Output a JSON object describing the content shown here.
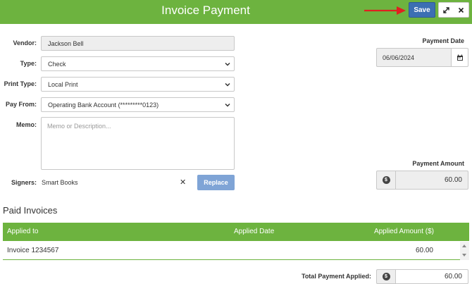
{
  "header": {
    "title": "Invoice Payment",
    "save_label": "Save",
    "expand_icon": "expand-icon",
    "close_icon": "close-icon",
    "color": "#6db33f"
  },
  "form": {
    "vendor_label": "Vendor:",
    "vendor_value": "Jackson Bell",
    "type_label": "Type:",
    "type_value": "Check",
    "print_type_label": "Print Type:",
    "print_type_value": "Local Print",
    "pay_from_label": "Pay From:",
    "pay_from_value": "Operating Bank Account (*********0123)",
    "memo_label": "Memo:",
    "memo_placeholder": "Memo or Description...",
    "signers_label": "Signers:",
    "signers_value": "Smart Books",
    "replace_label": "Replace"
  },
  "right": {
    "payment_date_label": "Payment Date",
    "payment_date_value": "06/06/2024",
    "payment_amount_label": "Payment Amount",
    "payment_amount_value": "60.00"
  },
  "paid_invoices": {
    "title": "Paid Invoices",
    "columns": [
      "Applied to",
      "Applied Date",
      "Applied Amount ($)"
    ],
    "rows": [
      {
        "applied_to": "Invoice 1234567",
        "applied_date": "",
        "applied_amount": "60.00"
      }
    ],
    "total_label": "Total Payment Applied:",
    "total_value": "60.00"
  }
}
